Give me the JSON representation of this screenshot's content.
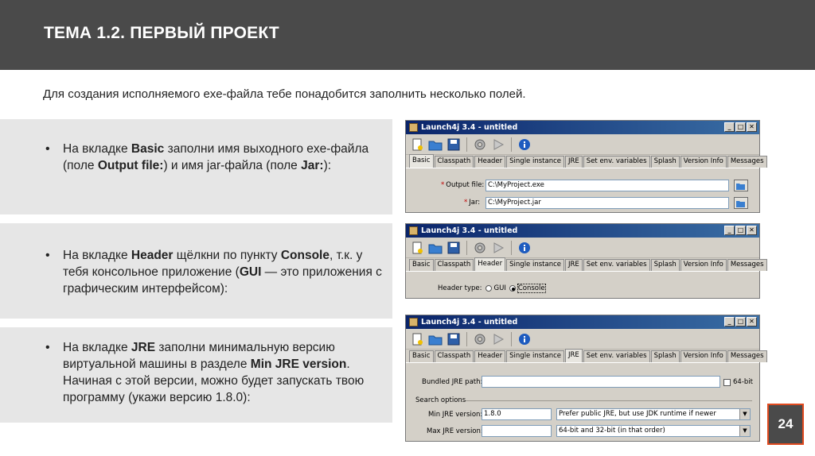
{
  "header": {
    "title": "ТЕМА 1.2. ПЕРВЫЙ ПРОЕКТ"
  },
  "intro": "Для создания исполняемого exe-файла тебе понадобится заполнить несколько полей.",
  "bullets": [
    {
      "t1": "На вкладке ",
      "b1": "Basic",
      "t2": " заполни имя выходного exe-файла (поле ",
      "b2": "Output file:",
      "t3": ") и имя jar-файла (поле ",
      "b3": "Jar:",
      "t4": "):"
    },
    {
      "t1": "На вкладке ",
      "b1": "Header",
      "t2": " щёлкни по пункту ",
      "b2": "Console",
      "t3": ", т.к. у тебя консольное приложение (",
      "b3": "GUI",
      "t4": " — это приложения с графическим интерфейсом):"
    },
    {
      "t1": "На вкладке ",
      "b1": "JRE",
      "t2": " заполни минимальную версию виртуальной машины в разделе ",
      "b2": "Min JRE version",
      "t3": ". Начиная с этой версии, можно будет запускать твою программу (укажи версию 1.8.0):"
    }
  ],
  "windows": {
    "title": "Launch4j 3.4 - untitled",
    "buttons": {
      "minimize": "_",
      "maximize": "□",
      "close": "✕"
    },
    "tabs": [
      "Basic",
      "Classpath",
      "Header",
      "Single instance",
      "JRE",
      "Set env. variables",
      "Splash",
      "Version Info",
      "Messages"
    ]
  },
  "basic": {
    "output_label": "Output file:",
    "output_value": "C:\\MyProject.exe",
    "jar_label": "Jar:",
    "jar_value": "C:\\MyProject.jar",
    "required_mark": "*"
  },
  "header_tab": {
    "type_label": "Header type:",
    "gui": "GUI",
    "console": "Console",
    "selected": "Console"
  },
  "jre": {
    "bundled_label": "Bundled JRE path:",
    "bit64": "64-bit",
    "search_label": "Search options",
    "min_label": "Min JRE version:",
    "min_value": "1.8.0",
    "max_label": "Max JRE version:",
    "prefer_value": "Prefer public JRE, but use JDK runtime if newer",
    "arch_value": "64-bit and 32-bit (in that order)"
  },
  "page_number": "24",
  "icons": [
    "new-file-icon",
    "open-folder-icon",
    "save-icon",
    "gear-icon",
    "run-icon",
    "info-icon",
    "browse-folder-icon"
  ],
  "colors": {
    "band": "#4a4a4a",
    "panel": "#e6e6e6",
    "accent": "#e04a1f",
    "titlebar": "#0a246a"
  }
}
